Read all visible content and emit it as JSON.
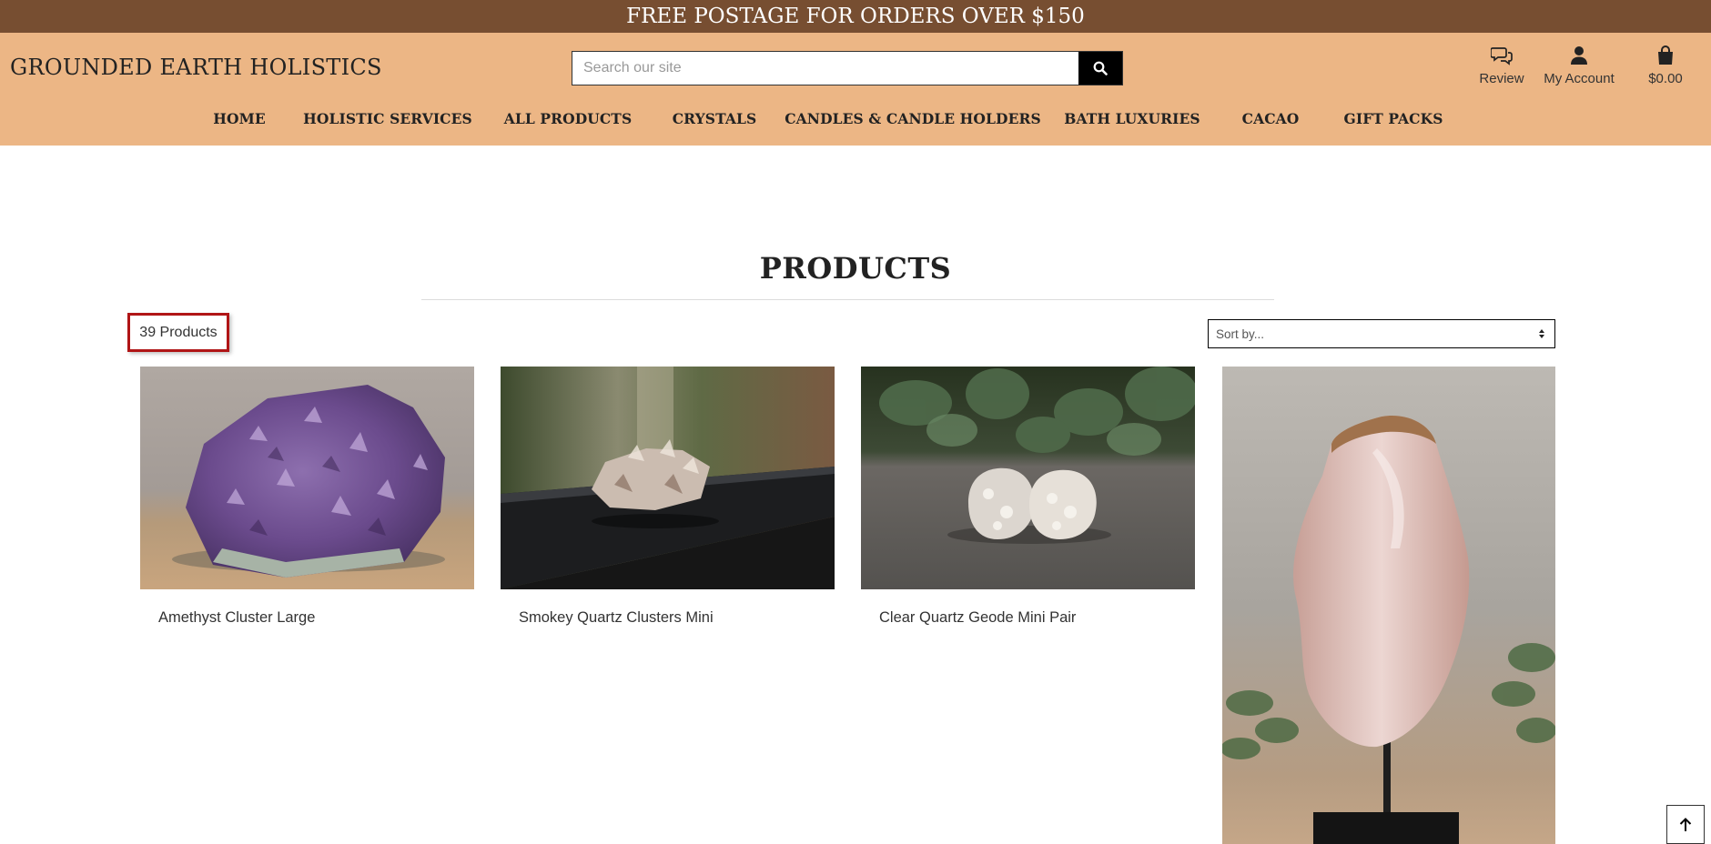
{
  "announcement": "FREE POSTAGE FOR ORDERS OVER $150",
  "brand": "GROUNDED EARTH HOLISTICS",
  "search": {
    "placeholder": "Search our site"
  },
  "header_links": {
    "review": "Review",
    "account": "My Account",
    "cart": "$0.00"
  },
  "nav": [
    "HOME",
    "HOLISTIC SERVICES",
    "ALL PRODUCTS",
    "CRYSTALS",
    "CANDLES & CANDLE HOLDERS",
    "BATH LUXURIES",
    "CACAO",
    "GIFT PACKS"
  ],
  "page_title": "PRODUCTS",
  "product_count": "39 Products",
  "sort": {
    "selected": "Sort by..."
  },
  "products": [
    {
      "name": "Amethyst Cluster Large"
    },
    {
      "name": "Smokey Quartz Clusters Mini"
    },
    {
      "name": "Clear Quartz Geode Mini Pair"
    },
    {
      "name": ""
    }
  ],
  "colors": {
    "announcement_bg": "#774e31",
    "header_bg": "#ecb685",
    "count_highlight": "#b01516"
  },
  "icons": {
    "search": "search-icon",
    "review": "chat-icon",
    "account": "user-icon",
    "cart": "shopping-bag-icon",
    "back_to_top": "arrow-up-icon"
  }
}
